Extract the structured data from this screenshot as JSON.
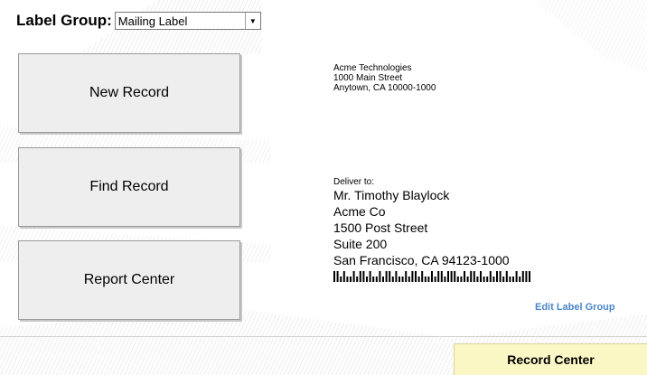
{
  "label_group": {
    "label": "Label Group:",
    "selected": "Mailing Label"
  },
  "buttons": {
    "new_record": "New Record",
    "find_record": "Find Record",
    "report_center": "Report Center"
  },
  "sender": {
    "line1": "Acme Technologies",
    "line2": "1000 Main Street",
    "line3": "Anytown, CA  10000-1000"
  },
  "recipient": {
    "deliver_to": "Deliver to:",
    "name": "Mr. Timothy Blaylock",
    "company": "Acme Co",
    "street": "1500 Post Street",
    "suite": "Suite 200",
    "city_line": "San Francisco, CA  94123-1000"
  },
  "links": {
    "edit_label_group": "Edit Label Group"
  },
  "footer": {
    "record_center": "Record Center"
  },
  "colors": {
    "button_bg": "#eeeeee",
    "link": "#4a86c8",
    "record_center_bg": "#fbf7c5"
  }
}
